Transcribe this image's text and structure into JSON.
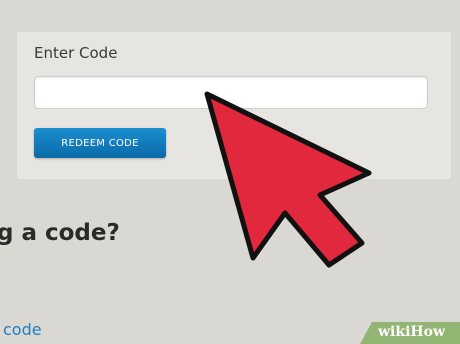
{
  "redeem_panel": {
    "title": "Enter Code",
    "input_value": "",
    "button_label": "REDEEM CODE"
  },
  "content": {
    "question_heading": "g a code?",
    "link_text": "code"
  },
  "overlay": {
    "cursor_icon": "arrow-cursor-icon",
    "cursor_color": "#e2283c",
    "watermark": "wikiHow"
  },
  "colors": {
    "background": "#d9d8d2",
    "panel": "#e6e5e1",
    "button": "#1379bb",
    "link": "#1f7fc2",
    "watermark": "#93b574"
  }
}
